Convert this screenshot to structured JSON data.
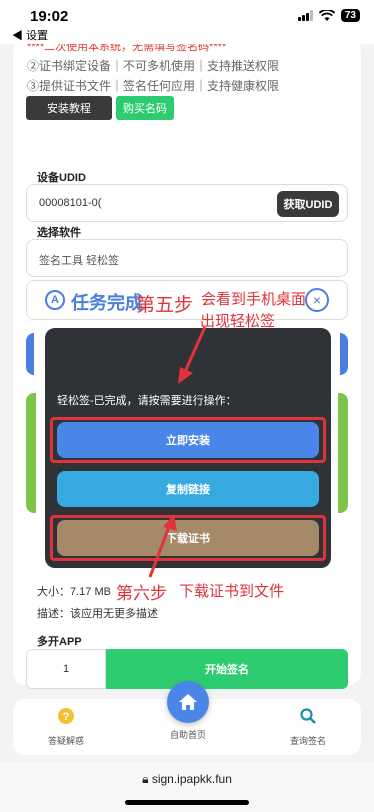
{
  "status": {
    "time": "19:02",
    "battery": "73"
  },
  "nav": {
    "back_label": "◀ 设置"
  },
  "top_card": {
    "note": "****二次使用本系统，无需填写签名码****",
    "features": [
      "②证书绑定设备｜不可多机使用｜支持推送权限",
      "③提供证书文件｜签名任何应用｜支持健康权限"
    ],
    "tutorial_label": "安装教程",
    "buy_label": "购买名码"
  },
  "udid": {
    "label": "设备UDID",
    "value": "00008101-0(",
    "button": "获取UDID"
  },
  "software": {
    "label": "选择软件",
    "value": "签名工具 轻松签"
  },
  "task": {
    "title": "任务完成",
    "close": "×"
  },
  "dialog": {
    "message": "轻松签-已完成，请按需要进行操作：",
    "install": "立即安装",
    "copy": "复制链接",
    "download": "下载证书"
  },
  "app_info": {
    "size": "大小：7.17 MB",
    "desc": "描述：该应用无更多描述"
  },
  "multi": {
    "label": "多开APP",
    "qty": "1",
    "start": "开始签名"
  },
  "annotations": {
    "step5": "第五步",
    "step5_note_1": "会看到手机桌面",
    "step5_note_2": "出现轻松签",
    "step6": "第六步",
    "step6_note": "下载证书到文件"
  },
  "bottom_nav": {
    "left": "答疑解惑",
    "center": "自助首页",
    "right": "查询签名"
  },
  "url": "sign.ipapkk.fun",
  "colors": {
    "accent": "#4a86e8",
    "green": "#2ecc71",
    "annotation_red": "#e0343a"
  },
  "icons": [
    "signal-icon",
    "wifi-icon",
    "battery-icon",
    "app-store-icon",
    "close-icon",
    "help-icon",
    "home-icon",
    "search-icon",
    "lock-icon"
  ]
}
